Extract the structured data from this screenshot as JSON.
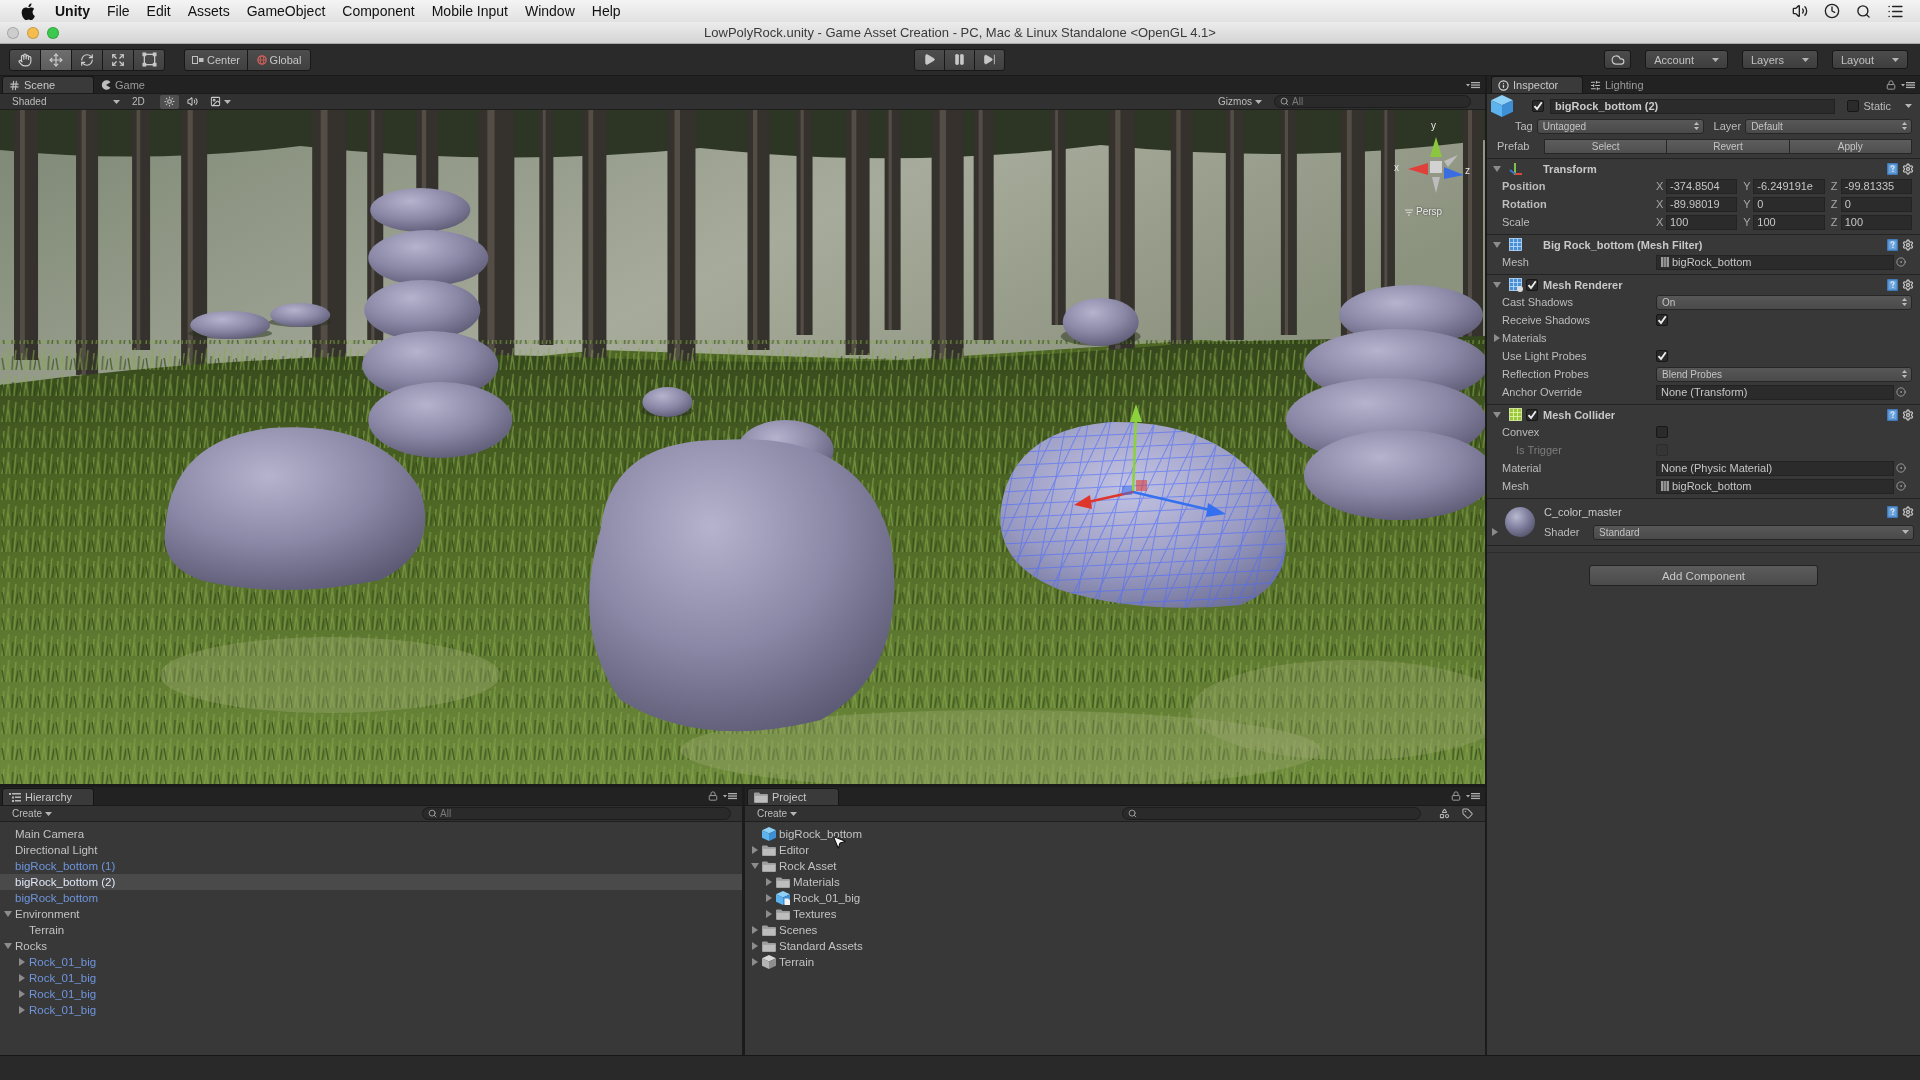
{
  "menu_bar": {
    "app": "Unity",
    "items": [
      "File",
      "Edit",
      "Assets",
      "GameObject",
      "Component",
      "Mobile Input",
      "Window",
      "Help"
    ]
  },
  "window": {
    "title": "LowPolyRock.unity - Game Asset Creation - PC, Mac & Linux Standalone <OpenGL 4.1>"
  },
  "toolbar": {
    "tools": [
      {
        "kind": "hand",
        "selected": false
      },
      {
        "kind": "move",
        "selected": true
      },
      {
        "kind": "rotate",
        "selected": false
      },
      {
        "kind": "scale",
        "selected": false
      },
      {
        "kind": "rect",
        "selected": false
      }
    ],
    "pivot_mode": "Center",
    "pivot_rotation": "Global",
    "playback": [
      {
        "kind": "play"
      },
      {
        "kind": "pause"
      },
      {
        "kind": "step"
      }
    ],
    "menus": [
      "Account",
      "Layers",
      "Layout"
    ]
  },
  "scene_panel": {
    "tabs": [
      {
        "kind": "scene",
        "label": "Scene",
        "selected": true
      },
      {
        "kind": "game",
        "label": "Game",
        "selected": false
      }
    ],
    "draw_mode": "Shaded",
    "mode_2d": {
      "label": "2D",
      "on": false
    },
    "toggles": [
      {
        "kind": "lighting",
        "on": true
      },
      {
        "kind": "audio",
        "on": false
      },
      {
        "kind": "effects",
        "on": false
      }
    ],
    "gizmos": "Gizmos",
    "search": {
      "placeholder": "All"
    },
    "orientation": {
      "axes": [
        "y",
        "x",
        "z"
      ],
      "projection": "Persp"
    }
  },
  "inspector": {
    "tabs": [
      {
        "kind": "info",
        "label": "Inspector",
        "selected": true
      },
      {
        "kind": "lighting",
        "label": "Lighting",
        "selected": false
      }
    ],
    "object": {
      "active": true,
      "name": "bigRock_bottom (2)",
      "static_label": "Static",
      "static": false,
      "tag_label": "Tag",
      "tag": "Untagged",
      "layer_label": "Layer",
      "layer": "Default",
      "prefab_label": "Prefab",
      "prefab_buttons": [
        "Select",
        "Revert",
        "Apply"
      ]
    },
    "components": [
      {
        "kind": "transform",
        "title": "Transform",
        "expanded": true,
        "properties": [
          {
            "kind": "vector3",
            "label": "Position",
            "modified": true,
            "axes": [
              {
                "axis": "X",
                "value": "-374.8504"
              },
              {
                "axis": "Y",
                "value": "-6.249191e"
              },
              {
                "axis": "Z",
                "value": "-99.81335"
              }
            ]
          },
          {
            "kind": "vector3",
            "label": "Rotation",
            "modified": true,
            "axes": [
              {
                "axis": "X",
                "value": "-89.98019"
              },
              {
                "axis": "Y",
                "value": "0"
              },
              {
                "axis": "Z",
                "value": "0"
              }
            ]
          },
          {
            "kind": "vector3",
            "label": "Scale",
            "modified": false,
            "axes": [
              {
                "axis": "X",
                "value": "100"
              },
              {
                "axis": "Y",
                "value": "100"
              },
              {
                "axis": "Z",
                "value": "100"
              }
            ]
          }
        ]
      },
      {
        "kind": "mesh_filter",
        "title": "Big Rock_bottom (Mesh Filter)",
        "expanded": true,
        "properties": [
          {
            "kind": "object",
            "label": "Mesh",
            "value": "bigRock_bottom",
            "assigned": true
          }
        ]
      },
      {
        "kind": "mesh_renderer",
        "title": "Mesh Renderer",
        "enabled": true,
        "expanded": true,
        "properties": [
          {
            "kind": "dropdown",
            "label": "Cast Shadows",
            "value": "On"
          },
          {
            "kind": "checkbox",
            "label": "Receive Shadows",
            "checked": true
          },
          {
            "kind": "foldout",
            "label": "Materials",
            "expanded": false
          },
          {
            "kind": "checkbox",
            "label": "Use Light Probes",
            "checked": true
          },
          {
            "kind": "dropdown",
            "label": "Reflection Probes",
            "value": "Blend Probes"
          },
          {
            "kind": "object",
            "label": "Anchor Override",
            "value": "None (Transform)",
            "assigned": false
          }
        ]
      },
      {
        "kind": "mesh_collider",
        "title": "Mesh Collider",
        "enabled": true,
        "expanded": true,
        "properties": [
          {
            "kind": "checkbox",
            "label": "Convex",
            "checked": false,
            "children": [
              {
                "kind": "checkbox",
                "label": "Is Trigger",
                "checked": false,
                "disabled": true
              }
            ]
          },
          {
            "kind": "object",
            "label": "Material",
            "value": "None (Physic Material)",
            "assigned": false
          },
          {
            "kind": "object",
            "label": "Mesh",
            "value": "bigRock_bottom",
            "assigned": true
          }
        ]
      },
      {
        "kind": "material",
        "title": "C_color_master",
        "expanded": false,
        "shader_label": "Shader",
        "shader": "Standard"
      }
    ],
    "add_button": "Add Component"
  },
  "hierarchy": {
    "tabs": [
      {
        "label": "Hierarchy",
        "selected": true
      }
    ],
    "create": "Create",
    "search": {
      "placeholder": "All"
    },
    "items": [
      {
        "label": "Main Camera",
        "prefab": false,
        "selected": false
      },
      {
        "label": "Directional Light",
        "prefab": false,
        "selected": false
      },
      {
        "label": "bigRock_bottom (1)",
        "prefab": true,
        "selected": false
      },
      {
        "label": "bigRock_bottom (2)",
        "prefab": true,
        "selected": true
      },
      {
        "label": "bigRock_bottom",
        "prefab": true,
        "selected": false
      },
      {
        "label": "Environment",
        "prefab": false,
        "selected": false,
        "expanded": true,
        "children": [
          {
            "label": "Terrain",
            "prefab": false,
            "selected": false
          }
        ]
      },
      {
        "label": "Rocks",
        "prefab": false,
        "selected": false,
        "expanded": true,
        "children": [
          {
            "label": "Rock_01_big",
            "prefab": true,
            "selected": false,
            "expanded": false
          },
          {
            "label": "Rock_01_big",
            "prefab": true,
            "selected": false,
            "expanded": false
          },
          {
            "label": "Rock_01_big",
            "prefab": true,
            "selected": false,
            "expanded": false
          },
          {
            "label": "Rock_01_big",
            "prefab": true,
            "selected": false,
            "expanded": false
          }
        ]
      }
    ]
  },
  "project": {
    "tabs": [
      {
        "label": "Project",
        "selected": true
      }
    ],
    "create": "Create",
    "items": [
      {
        "label": "bigRock_bottom",
        "kind": "prefab"
      },
      {
        "label": "Editor",
        "kind": "folder",
        "expanded": false
      },
      {
        "label": "Rock Asset",
        "kind": "folder",
        "expanded": true,
        "children": [
          {
            "label": "Materials",
            "kind": "folder",
            "expanded": false
          },
          {
            "label": "Rock_01_big",
            "kind": "model",
            "expanded": false
          },
          {
            "label": "Textures",
            "kind": "folder",
            "expanded": false
          }
        ]
      },
      {
        "label": "Scenes",
        "kind": "folder",
        "expanded": false
      },
      {
        "label": "Standard Assets",
        "kind": "folder",
        "expanded": false
      },
      {
        "label": "Terrain",
        "kind": "terrain",
        "expanded": false
      }
    ]
  }
}
